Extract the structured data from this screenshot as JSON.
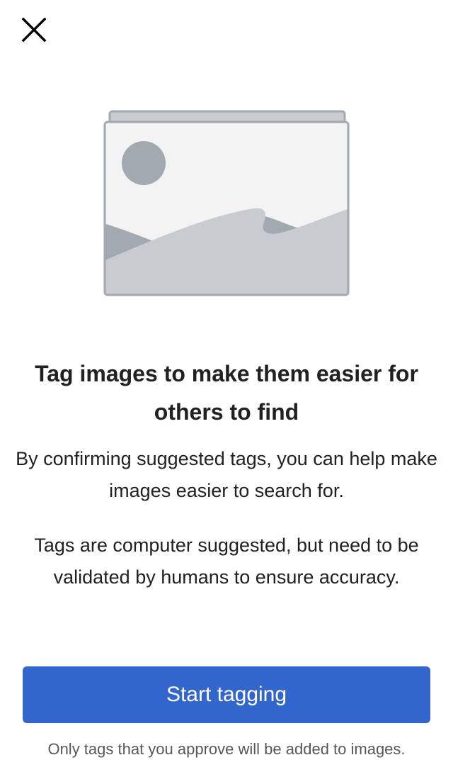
{
  "close": {
    "icon": "close-icon"
  },
  "illustration": {
    "icon": "image-placeholder-icon"
  },
  "title": "Tag images to make them easier for others to find",
  "paragraphs": [
    "By confirming suggested tags, you can help make images easier to search for.",
    "Tags are computer suggested, but need to be validated by humans to ensure accuracy."
  ],
  "start_button": {
    "label": "Start tagging"
  },
  "footnote": "Only tags that you approve will be added to images.",
  "colors": {
    "accent": "#3366cc",
    "text": "#202122",
    "subtle_text": "#54595d",
    "placeholder_frame": "#a2a9b1",
    "placeholder_fill": "#c8ccd1",
    "placeholder_bg": "#f3f3f3"
  }
}
